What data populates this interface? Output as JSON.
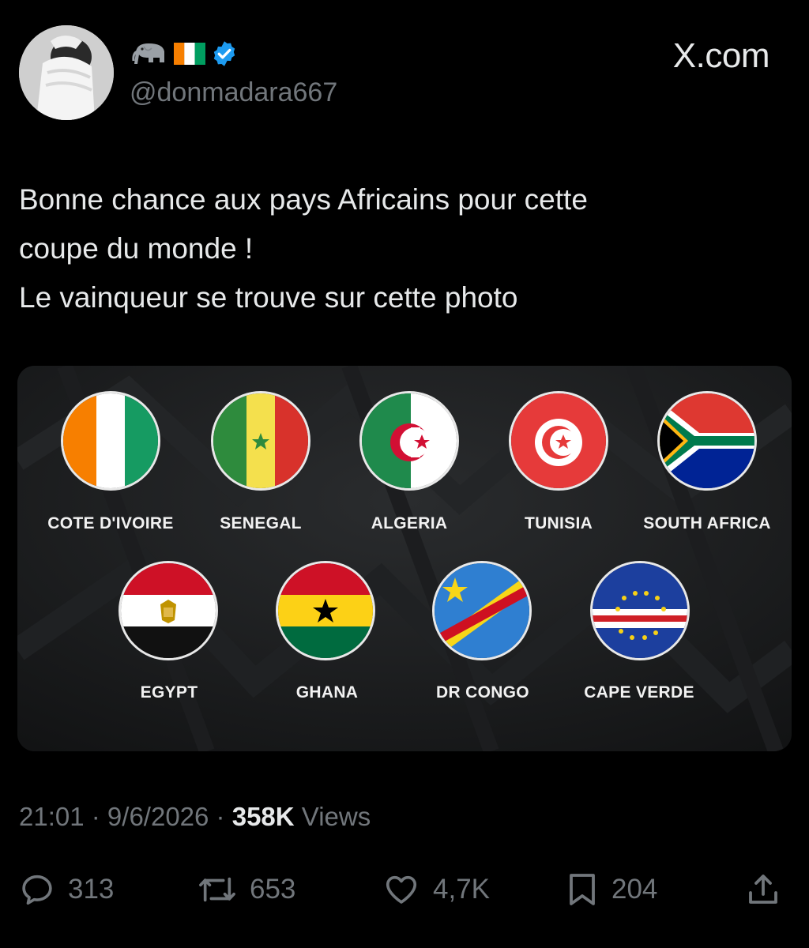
{
  "author": {
    "handle": "@donmadara667",
    "verified": true,
    "name_emojis": [
      "elephant-icon",
      "ivory-coast-flag-icon"
    ],
    "avatar": "user-avatar"
  },
  "brand": "X.com",
  "tweet": {
    "lines": [
      "Bonne chance aux pays Africains pour cette",
      "coupe du monde !",
      "Le vainqueur se trouve sur cette photo"
    ]
  },
  "media": {
    "row1": [
      {
        "name": "COTE D'IVOIRE",
        "flag": "cote-divoire-flag"
      },
      {
        "name": "SENEGAL",
        "flag": "senegal-flag"
      },
      {
        "name": "ALGERIA",
        "flag": "algeria-flag"
      },
      {
        "name": "TUNISIA",
        "flag": "tunisia-flag"
      },
      {
        "name": "SOUTH AFRICA",
        "flag": "south-africa-flag"
      }
    ],
    "row2": [
      {
        "name": "EGYPT",
        "flag": "egypt-flag"
      },
      {
        "name": "GHANA",
        "flag": "ghana-flag"
      },
      {
        "name": "DR CONGO",
        "flag": "dr-congo-flag"
      },
      {
        "name": "CAPE VERDE",
        "flag": "cape-verde-flag"
      }
    ]
  },
  "meta": {
    "time": "21:01",
    "separator": " · ",
    "date": "9/6/2026",
    "views_count": "358K",
    "views_label": " Views"
  },
  "actions": {
    "replies": "313",
    "reposts": "653",
    "likes": "4,7K",
    "bookmarks": "204"
  },
  "colors": {
    "background": "#000000",
    "text": "#e7e9ea",
    "secondary": "#71767b",
    "verified": "#1d9bf0"
  }
}
